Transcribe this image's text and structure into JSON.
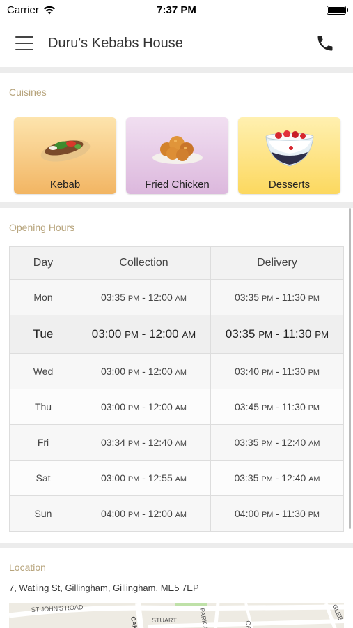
{
  "status_bar": {
    "carrier": "Carrier",
    "time": "7:37 PM"
  },
  "header": {
    "title": "Duru's Kebabs House"
  },
  "cuisines": {
    "title": "Cuisines",
    "items": [
      {
        "label": "Kebab",
        "icon": "kebab-image"
      },
      {
        "label": "Fried Chicken",
        "icon": "fried-chicken-image"
      },
      {
        "label": "Desserts",
        "icon": "dessert-image"
      }
    ]
  },
  "opening_hours": {
    "title": "Opening Hours",
    "headers": [
      "Day",
      "Collection",
      "Delivery"
    ],
    "rows": [
      {
        "day": "Mon",
        "collection": [
          "03:35",
          "PM",
          "12:00",
          "AM"
        ],
        "delivery": [
          "03:35",
          "PM",
          "11:30",
          "PM"
        ]
      },
      {
        "day": "Tue",
        "collection": [
          "03:00",
          "PM",
          "12:00",
          "AM"
        ],
        "delivery": [
          "03:35",
          "PM",
          "11:30",
          "PM"
        ]
      },
      {
        "day": "Wed",
        "collection": [
          "03:00",
          "PM",
          "12:00",
          "AM"
        ],
        "delivery": [
          "03:40",
          "PM",
          "11:30",
          "PM"
        ]
      },
      {
        "day": "Thu",
        "collection": [
          "03:00",
          "PM",
          "12:00",
          "AM"
        ],
        "delivery": [
          "03:45",
          "PM",
          "11:30",
          "PM"
        ]
      },
      {
        "day": "Fri",
        "collection": [
          "03:34",
          "PM",
          "12:40",
          "AM"
        ],
        "delivery": [
          "03:35",
          "PM",
          "12:40",
          "AM"
        ]
      },
      {
        "day": "Sat",
        "collection": [
          "03:00",
          "PM",
          "12:55",
          "AM"
        ],
        "delivery": [
          "03:35",
          "PM",
          "12:40",
          "AM"
        ]
      },
      {
        "day": "Sun",
        "collection": [
          "04:00",
          "PM",
          "12:00",
          "AM"
        ],
        "delivery": [
          "04:00",
          "PM",
          "11:30",
          "PM"
        ]
      }
    ]
  },
  "location": {
    "title": "Location",
    "address": "7, Watling St, Gillingham, Gillingham, ME5 7EP",
    "map_labels": [
      "ST JOHN'S ROAD",
      "CAN",
      "STUART",
      "PARK AV",
      "OAD",
      "GLEB"
    ]
  },
  "colors": {
    "section_title": "#b7a47c",
    "divider": "#ececec"
  }
}
